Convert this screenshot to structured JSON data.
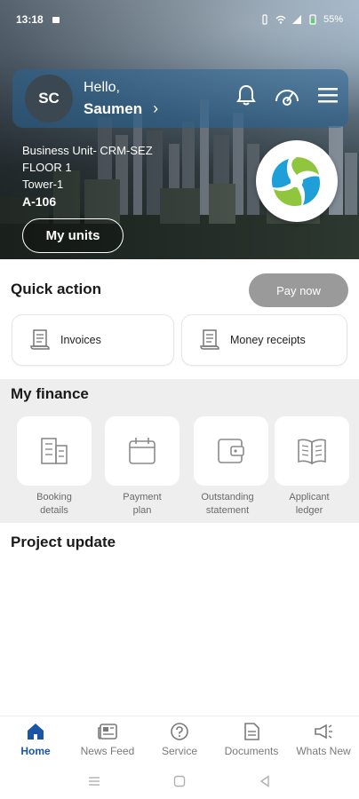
{
  "status_bar": {
    "time": "13:18",
    "battery": "55%"
  },
  "header": {
    "avatar_initials": "SC",
    "greeting": "Hello,",
    "user_name": "Saumen",
    "chevron": "›",
    "icons": [
      "bell-icon",
      "gauge-icon",
      "menu-icon"
    ]
  },
  "unit": {
    "business_unit": "Business Unit- CRM-SEZ",
    "floor": "FLOOR 1",
    "tower": "Tower-1",
    "code": "A-106",
    "my_units_label": "My units"
  },
  "quick_action": {
    "title": "Quick action",
    "pay_now_label": "Pay now",
    "items": [
      {
        "label": "Invoices",
        "icon": "receipt-icon"
      },
      {
        "label": "Money receipts",
        "icon": "receipt-icon"
      }
    ]
  },
  "my_finance": {
    "title": "My finance",
    "items": [
      {
        "line1": "Booking",
        "line2": "details",
        "icon": "building-icon"
      },
      {
        "line1": "Payment",
        "line2": "plan",
        "icon": "calendar-icon"
      },
      {
        "line1": "Outstanding",
        "line2": "statement",
        "icon": "wallet-icon"
      },
      {
        "line1": "Applicant",
        "line2": "ledger",
        "icon": "book-icon"
      }
    ]
  },
  "project_update": {
    "title": "Project update"
  },
  "bottom_nav": {
    "items": [
      {
        "label": "Home",
        "icon": "home-icon",
        "active": true
      },
      {
        "label": "News Feed",
        "icon": "newspaper-icon",
        "active": false
      },
      {
        "label": "Service",
        "icon": "help-icon",
        "active": false
      },
      {
        "label": "Documents",
        "icon": "document-icon",
        "active": false
      },
      {
        "label": "Whats New",
        "icon": "megaphone-icon",
        "active": false
      }
    ]
  },
  "colors": {
    "accent": "#1a56a6",
    "pay_now_bg": "#9a9a9a",
    "finance_bg": "#eeeeee"
  }
}
